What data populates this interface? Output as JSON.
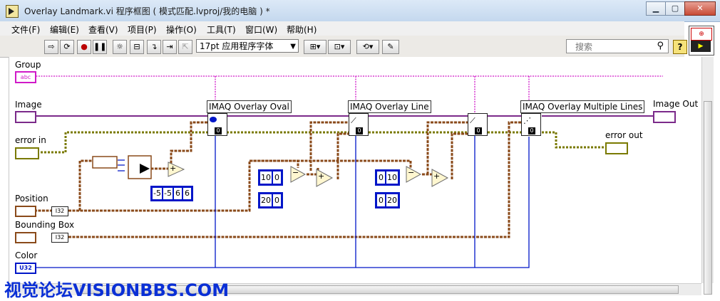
{
  "window": {
    "title": "Overlay Landmark.vi 程序框图 ( 模式匹配.lvproj/我的电脑 ) *",
    "minimize": "▁",
    "maximize": "▢",
    "close": "✕"
  },
  "menu": [
    "文件(F)",
    "编辑(E)",
    "查看(V)",
    "项目(P)",
    "操作(O)",
    "工具(T)",
    "窗口(W)",
    "帮助(H)"
  ],
  "toolbar": {
    "font": "17pt 应用程序字体",
    "search_placeholder": "搜索",
    "help_label": "?"
  },
  "connector": {
    "top": "⊕",
    "bottom": "▶"
  },
  "diagram": {
    "terminals": {
      "group": "Group",
      "image": "Image",
      "error_in": "error in",
      "position": "Position",
      "bounding_box": "Bounding Box",
      "color": "Color",
      "image_out": "Image Out",
      "error_out": "error out"
    },
    "type_labels": {
      "i32": "I32",
      "u32": "U32",
      "abc": "abc"
    },
    "nodes": {
      "oval": "IMAQ Overlay Oval",
      "line": "IMAQ Overlay Line",
      "multi": "IMAQ Overlay Multiple Lines"
    },
    "node_zero": "0",
    "constants": {
      "arr1": [
        "-5",
        "-5",
        "6",
        "6"
      ],
      "c1a": [
        "10",
        "0"
      ],
      "c1b": [
        "20",
        "0"
      ],
      "c2a": [
        "0",
        "10"
      ],
      "c2b": [
        "0",
        "20"
      ]
    },
    "ops": {
      "add": "+",
      "sub": "−"
    }
  },
  "watermark": "视觉论坛VISIONBBS.COM",
  "colors": {
    "pink": "#d019c8",
    "orange": "#8a4a1a",
    "blue": "#0016c8",
    "cluster": "#5a6e14",
    "error": "#7a7a00"
  }
}
